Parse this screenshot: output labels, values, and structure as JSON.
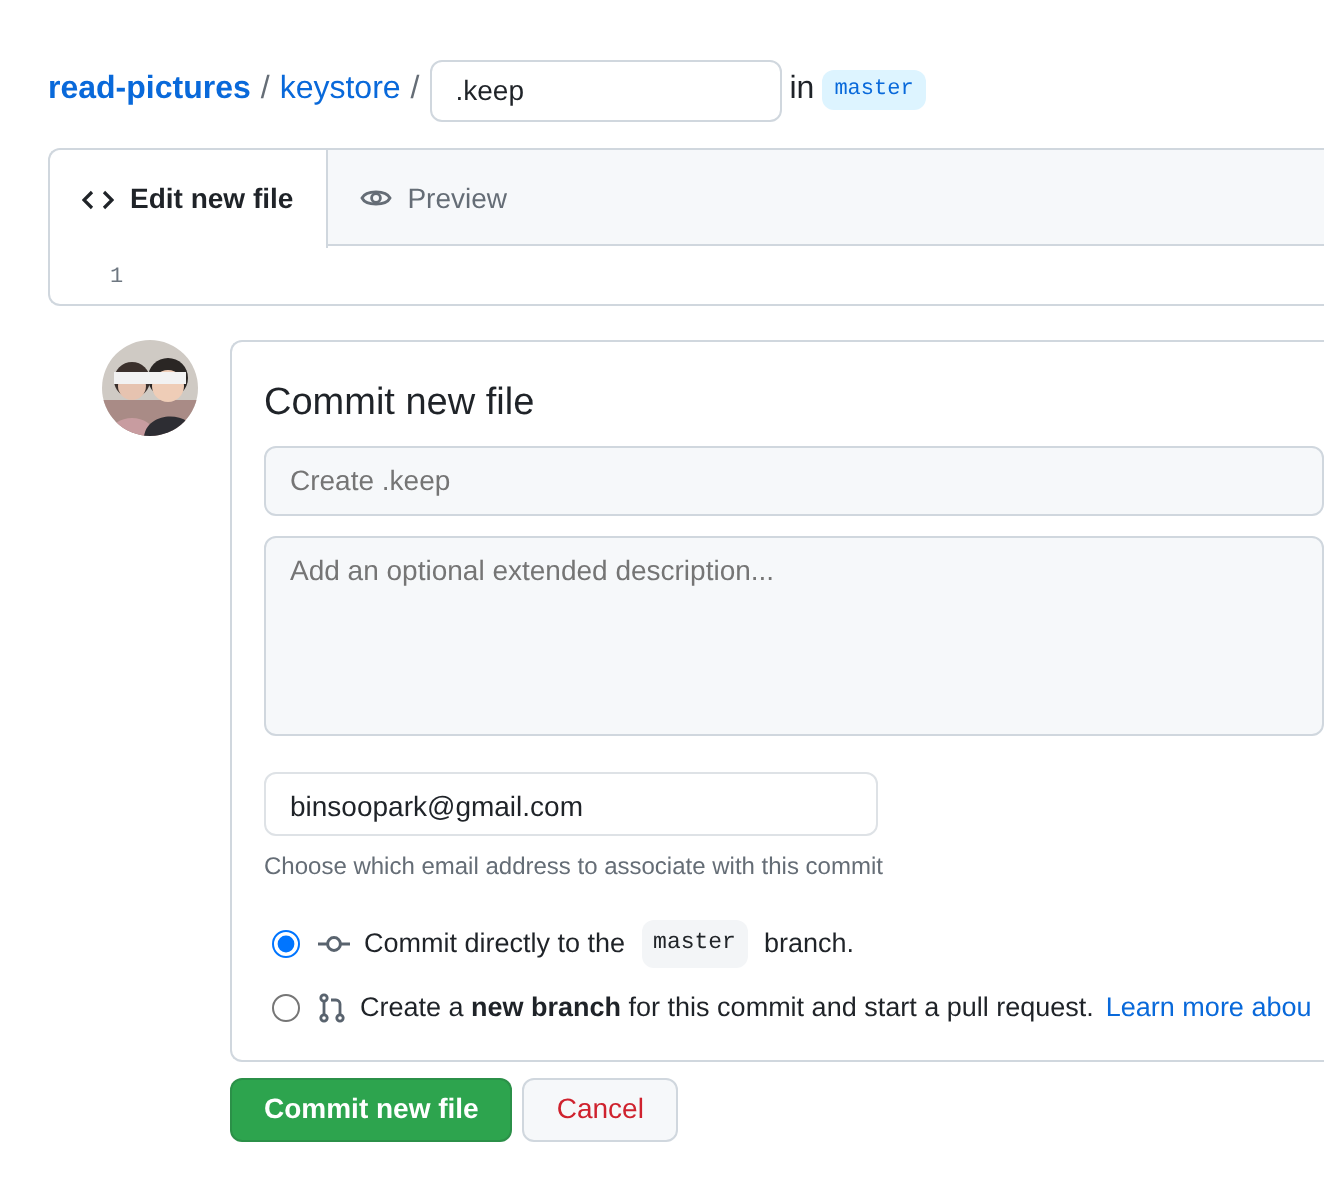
{
  "breadcrumb": {
    "repo": "read-pictures",
    "folder": "keystore",
    "separators": [
      "/",
      "/"
    ],
    "filename": ".keep",
    "in_label": "in",
    "branch": "master"
  },
  "editor": {
    "tabs": [
      {
        "label": "Edit new file",
        "kind": "edit",
        "selected": true
      },
      {
        "label": "Preview",
        "kind": "preview",
        "selected": false
      }
    ],
    "line_numbers": [
      "1"
    ]
  },
  "commit": {
    "title": "Commit new file",
    "summary": {
      "placeholder": "Create .keep"
    },
    "description": {
      "placeholder": "Add an optional extended description..."
    },
    "email": {
      "value": "binsoopark@gmail.com"
    },
    "email_note": "Choose which email address to associate with this commit",
    "options": [
      {
        "kind": "direct",
        "selected": true,
        "before": "Commit directly to the",
        "code": "master",
        "after": "branch."
      },
      {
        "kind": "pr",
        "selected": false,
        "text": "Create a **new branch** for this commit and start a pull request.",
        "link": "Learn more abou"
      }
    ]
  },
  "buttons": [
    {
      "kind": "primary",
      "label": "Commit new file"
    },
    {
      "kind": "cancel",
      "label": "Cancel"
    }
  ]
}
